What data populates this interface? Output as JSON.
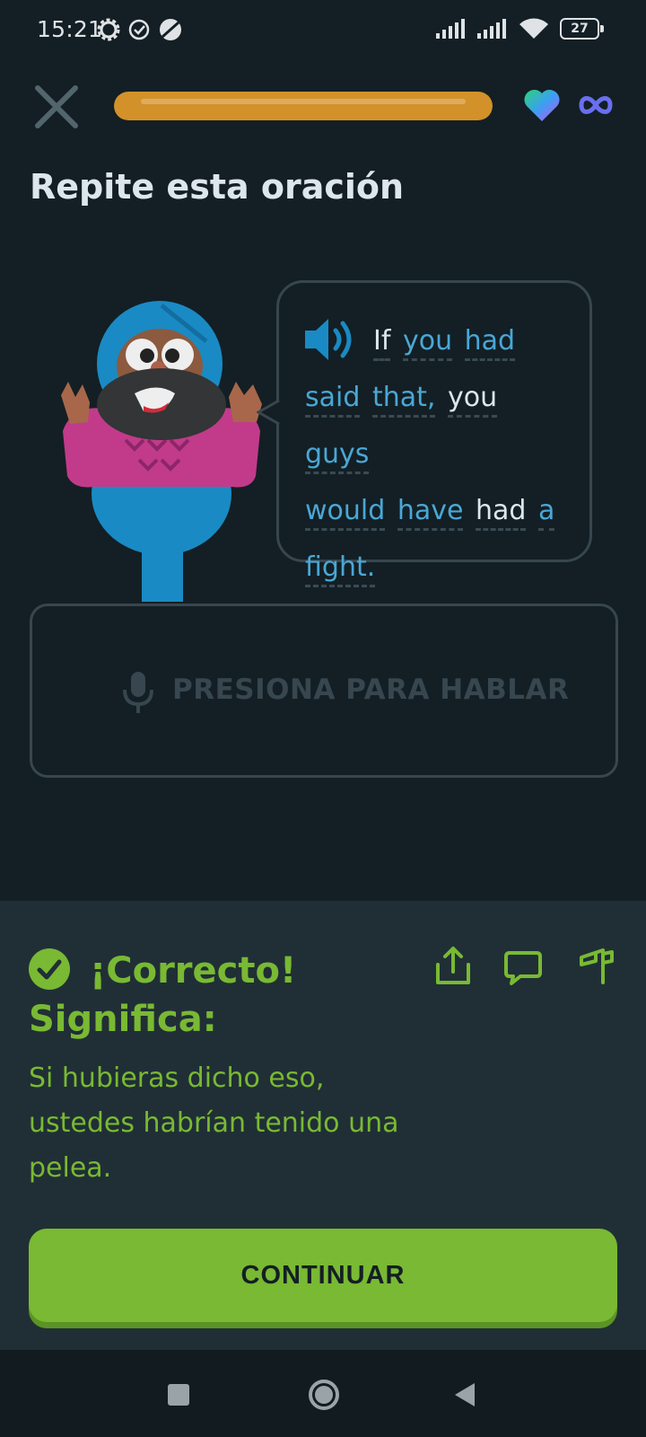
{
  "status_bar": {
    "time": "15:21",
    "battery": "27",
    "icons": [
      "settings-gear-icon",
      "check-circle-icon",
      "dnd-icon",
      "signal-icon",
      "signal-icon",
      "wifi-icon",
      "battery-icon"
    ]
  },
  "lesson": {
    "progress": 1.0,
    "progress_color": "#d39129",
    "hearts": "infinite",
    "title": "Repite esta oración"
  },
  "sentence": {
    "words": [
      "If",
      "you",
      "had",
      "said",
      "that,",
      "you",
      "guys",
      "would",
      "have",
      "had",
      "a",
      "fight."
    ]
  },
  "speak_button": {
    "label": "PRESIONA PARA HABLAR"
  },
  "result": {
    "status": "¡Correcto!",
    "means_label": "Significa:",
    "translation": "Si hubieras dicho eso, ustedes habrían tenido una pelea.",
    "color": "#79b933"
  },
  "actions": {
    "continue_label": "CONTINUAR"
  }
}
